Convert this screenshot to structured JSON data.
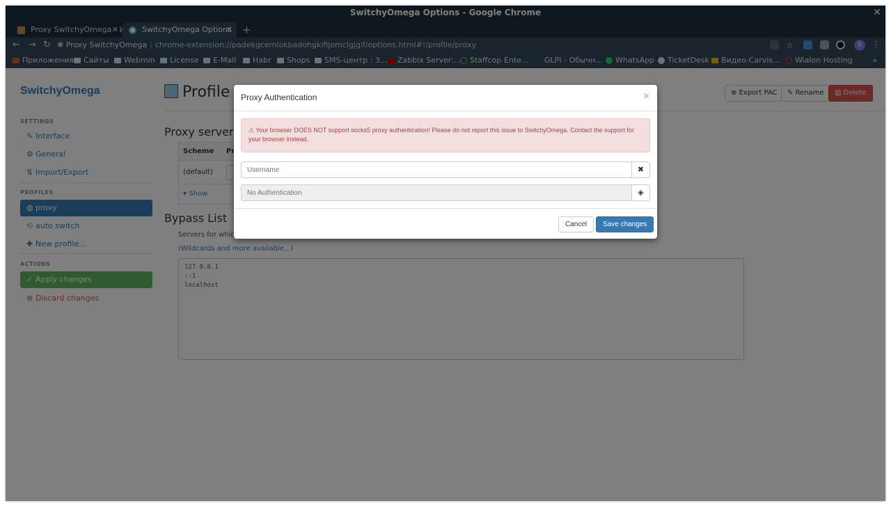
{
  "window": {
    "title": "SwitchyOmega Options - Google Chrome",
    "close_glyph": "✕"
  },
  "tabs": [
    {
      "label": "Proxy SwitchyOmega - Ин",
      "close": "✕",
      "active": false
    },
    {
      "label": "SwitchyOmega Options",
      "close": "✕",
      "active": true
    }
  ],
  "newtab_glyph": "+",
  "address": {
    "site_label": "Proxy SwitchyOmega",
    "url": "chrome-extension://padekgcemlokbadohgkifijomclgjgif/options.html#!/profile/proxy",
    "avatar_letter": "S"
  },
  "bookmarks": [
    "Приложения",
    "Сайты",
    "Webmin",
    "License",
    "E-Mail",
    "Habr",
    "Shops",
    "SMS-центр : 3...",
    "Zabbix Server:...",
    "Staffcop Ente...",
    "GLPI - Обычн...",
    "WhatsApp",
    "TicketDesk",
    "Видео-Carvis...",
    "Wialon Hosting"
  ],
  "bookmarks_more": "»",
  "sidebar": {
    "brand": "SwitchyOmega",
    "settings_header": "SETTINGS",
    "settings_items": [
      "Interface",
      "General",
      "Import/Export"
    ],
    "profiles_header": "PROFILES",
    "profile_items": [
      "proxy",
      "auto switch",
      "New profile..."
    ],
    "actions_header": "ACTIONS",
    "apply_label": "Apply changes",
    "discard_label": "Discard changes"
  },
  "main": {
    "title": "Profile ::",
    "export_pac": "Export PAC",
    "rename": "Rename",
    "delete": "Delete",
    "proxy_servers_title": "Proxy servers",
    "table_headers": [
      "Scheme",
      "Pr"
    ],
    "table_row_scheme": "(default)",
    "show_advanced": "Show Advance",
    "bypass_title": "Bypass List",
    "bypass_desc": "Servers for which y",
    "wildcards_link": "(Wildcards and more available...)",
    "bypass_list": "127.0.0.1\n::1\nlocalhost"
  },
  "modal": {
    "title": "Proxy Authentication",
    "close": "×",
    "alert_text": "Your browser DOES NOT support socks5 proxy authentication! Please do not report this issue to SwitchyOmega. Contact the support for your browser instead.",
    "username_placeholder": "Username",
    "password_placeholder": "No Authentication",
    "cancel": "Cancel",
    "save": "Save changes"
  },
  "colors": {
    "accent": "#337ab7",
    "success": "#5cb85c",
    "danger": "#d9534f",
    "alert_bg": "#f2dede",
    "alert_text": "#a94442",
    "chrome_dark": "#1f2f3d",
    "chrome_toolbar": "#35495a"
  },
  "icons": [
    "wrench-icon",
    "gear-icon",
    "import-export-icon",
    "globe-icon",
    "refresh-icon",
    "plus-icon",
    "check-circle-icon",
    "times-circle-icon",
    "warning-icon",
    "eye-slash-icon",
    "clear-icon"
  ]
}
